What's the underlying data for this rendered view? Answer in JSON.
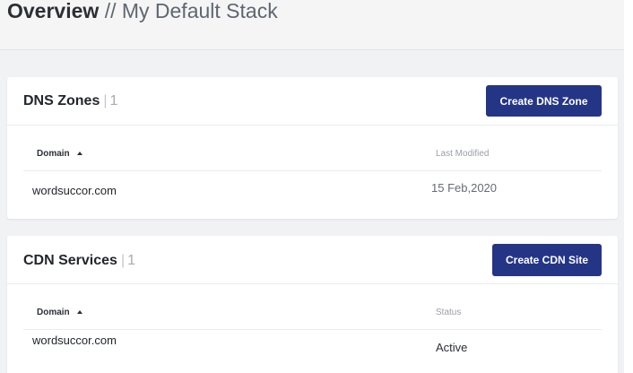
{
  "header": {
    "title_main": "Overview",
    "title_separator": "//",
    "title_stack": "My Default Stack"
  },
  "dns_zones": {
    "title": "DNS Zones",
    "separator": "|",
    "count": "1",
    "create_button_label": "Create DNS Zone",
    "columns": {
      "domain": "Domain",
      "last_modified": "Last Modified"
    },
    "rows": [
      {
        "domain": "wordsuccor.com",
        "last_modified": "15 Feb,2020"
      }
    ]
  },
  "cdn_services": {
    "title": "CDN Services",
    "separator": "|",
    "count": "1",
    "create_button_label": "Create CDN Site",
    "columns": {
      "domain": "Domain",
      "status": "Status"
    },
    "rows": [
      {
        "domain": "wordsuccor.com",
        "status": "Active"
      }
    ]
  },
  "colors": {
    "primary_button": "#253586",
    "page_background": "#f1f2f4",
    "card_background": "#ffffff"
  },
  "icons": {
    "sort": "sort-ascending-icon"
  }
}
